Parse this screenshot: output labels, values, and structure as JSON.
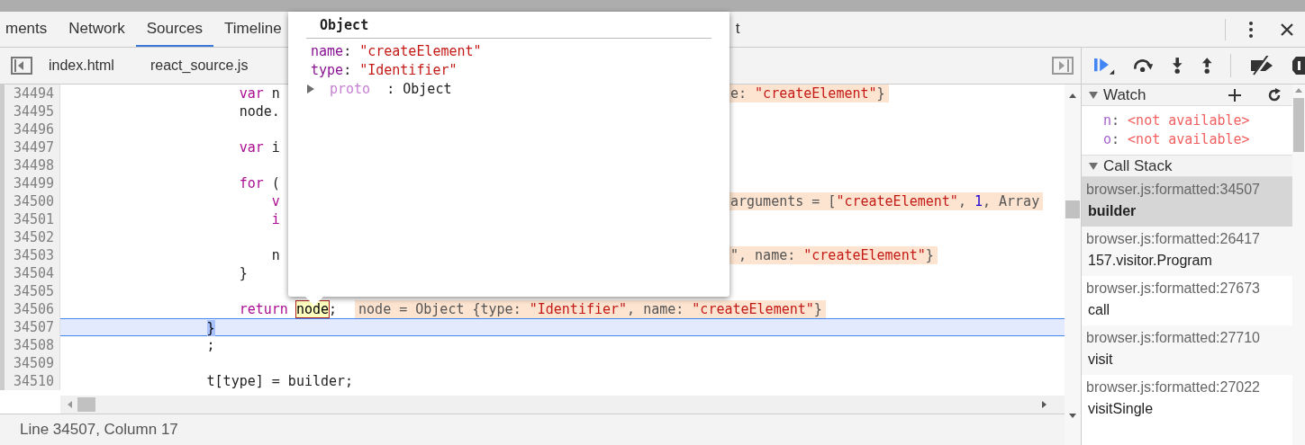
{
  "panel_tabs": [
    {
      "label": "ments",
      "selected": false
    },
    {
      "label": "Network",
      "selected": false
    },
    {
      "label": "Sources",
      "selected": true
    },
    {
      "label": "Timeline",
      "selected": false
    },
    {
      "label": "t",
      "selected": false
    }
  ],
  "file_tabs": [
    {
      "label": "index.html",
      "selected": false
    },
    {
      "label": "react_source.js",
      "selected": false
    }
  ],
  "code_lines": [
    {
      "number": "34494",
      "current": false,
      "code": [
        {
          "text": "                      var",
          "kind": "keyword"
        },
        {
          "text": " n",
          "kind": "plain"
        }
      ],
      "hint": {
        "kind": "beside-popover",
        "parts": [
          {
            "text": "e: ",
            "kind": "plain"
          },
          {
            "text": "\"createElement\"",
            "kind": "string"
          },
          {
            "text": "}",
            "kind": "plain"
          }
        ]
      }
    },
    {
      "number": "34495",
      "current": false,
      "code": [
        {
          "text": "                      node.",
          "kind": "plain"
        }
      ]
    },
    {
      "number": "34496",
      "current": false
    },
    {
      "number": "34497",
      "current": false,
      "code": [
        {
          "text": "                      var",
          "kind": "keyword"
        },
        {
          "text": " i",
          "kind": "plain"
        }
      ]
    },
    {
      "number": "34498",
      "current": false
    },
    {
      "number": "34499",
      "current": false,
      "code": [
        {
          "text": "                      for",
          "kind": "keyword"
        },
        {
          "text": " (",
          "kind": "plain"
        }
      ]
    },
    {
      "number": "34500",
      "current": false,
      "code": [
        {
          "text": "                          v",
          "kind": "keyword"
        }
      ],
      "hint": {
        "kind": "beside-popover",
        "parts": [
          {
            "text": "arguments = [",
            "kind": "plain"
          },
          {
            "text": "\"createElement\"",
            "kind": "string"
          },
          {
            "text": ", ",
            "kind": "plain"
          },
          {
            "text": "1",
            "kind": "number"
          },
          {
            "text": ", Array",
            "kind": "plain"
          }
        ]
      }
    },
    {
      "number": "34501",
      "current": false,
      "code": [
        {
          "text": "                          i",
          "kind": "keyword"
        }
      ]
    },
    {
      "number": "34502",
      "current": false
    },
    {
      "number": "34503",
      "current": false,
      "code": [
        {
          "text": "                          n",
          "kind": "plain"
        }
      ],
      "hint": {
        "kind": "beside-popover",
        "parts": [
          {
            "text": "\", name: ",
            "kind": "plain"
          },
          {
            "text": "\"createElement\"",
            "kind": "string"
          },
          {
            "text": "}",
            "kind": "plain"
          }
        ]
      }
    },
    {
      "number": "34504",
      "current": false,
      "code": [
        {
          "text": "                      }",
          "kind": "plain"
        }
      ]
    },
    {
      "number": "34505",
      "current": false
    },
    {
      "number": "34506",
      "current": false,
      "code": [
        {
          "text": "                      return ",
          "kind": "keyword"
        },
        {
          "text": "node",
          "kind": "hovered"
        },
        {
          "text": ";",
          "kind": "plain"
        }
      ],
      "hint": {
        "kind": "inline",
        "parts": [
          {
            "text": "node = Object {type: ",
            "kind": "plain"
          },
          {
            "text": "\"Identifier\"",
            "kind": "string"
          },
          {
            "text": ", name: ",
            "kind": "plain"
          },
          {
            "text": "\"createElement\"",
            "kind": "string"
          },
          {
            "text": "}",
            "kind": "plain"
          }
        ]
      }
    },
    {
      "number": "34507",
      "current": true,
      "code": [
        {
          "text": "                  }",
          "kind": "bracket"
        }
      ]
    },
    {
      "number": "34508",
      "current": false,
      "code": [
        {
          "text": "                  ;",
          "kind": "plain"
        }
      ]
    },
    {
      "number": "34509",
      "current": false
    },
    {
      "number": "34510",
      "current": false,
      "code": [
        {
          "text": "                  t[type] = builder;",
          "kind": "plain"
        }
      ]
    }
  ],
  "popover": {
    "title": "Object",
    "properties": [
      {
        "name": "name",
        "separator": ":",
        "value": "\"createElement\""
      },
      {
        "name": "type",
        "separator": ":",
        "value": "\"Identifier\""
      }
    ],
    "proto": {
      "name": "proto",
      "value": ": Object",
      "expanded": false
    }
  },
  "watch": {
    "title": "Watch",
    "expanded": true,
    "items": [
      {
        "name": "n",
        "separator": ":",
        "value": "<not available>"
      },
      {
        "name": "o",
        "separator": ":",
        "value": "<not available>"
      }
    ]
  },
  "call_stack": {
    "title": "Call Stack",
    "expanded": true,
    "frames": [
      {
        "location": "browser.js:formatted:34507",
        "function": "builder",
        "selected": true
      },
      {
        "location": "browser.js:formatted:26417",
        "function": "157.visitor.Program",
        "selected": false
      },
      {
        "location": "browser.js:formatted:27673",
        "function": "call",
        "selected": false
      },
      {
        "location": "browser.js:formatted:27710",
        "function": "visit",
        "selected": false
      },
      {
        "location": "browser.js:formatted:27022",
        "function": "visitSingle",
        "selected": false
      }
    ]
  },
  "status_bar": {
    "text": "Line 34507, Column 17"
  }
}
